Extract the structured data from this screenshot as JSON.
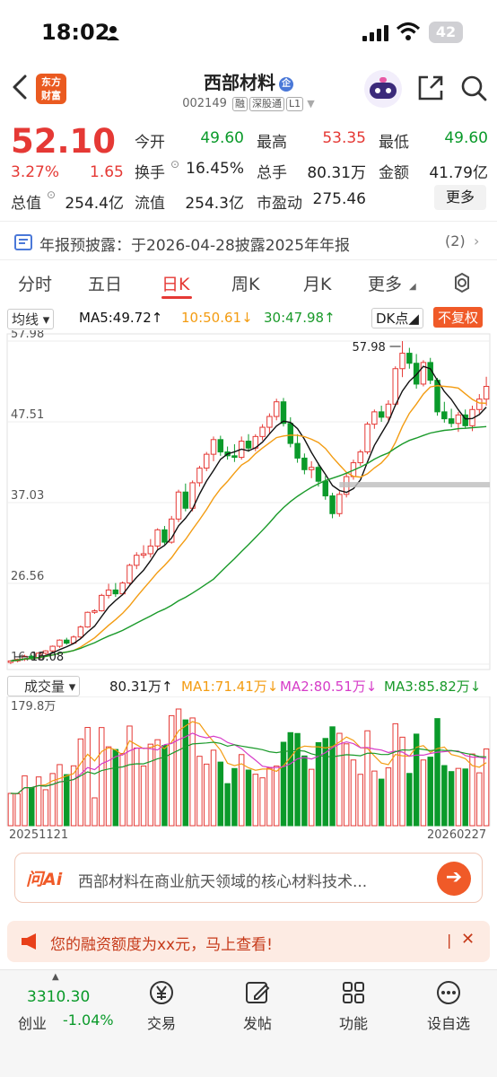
{
  "status": {
    "time": "18:02",
    "battery": "42"
  },
  "nav": {
    "logo_line1": "东方",
    "logo_line2": "财富",
    "name": "西部材料",
    "badge": "企",
    "code": "002149",
    "tags": [
      "融",
      "深股通",
      "L1"
    ]
  },
  "quote": {
    "price": "52.10",
    "pct": "3.27%",
    "change": "1.65",
    "labels": [
      "今开",
      "最高",
      "最低",
      "换手",
      "总手",
      "金额",
      "总值",
      "流值",
      "市盈动"
    ],
    "open": "49.60",
    "high": "53.35",
    "low": "49.60",
    "turnover": "16.45%",
    "volume": "80.31万",
    "amount": "41.79亿",
    "mktcap": "254.4亿",
    "float": "254.3亿",
    "pe": "275.46",
    "more": "更多"
  },
  "notice": {
    "text": "年报预披露：于2026-04-28披露2025年年报",
    "count": "(2)"
  },
  "tabs": [
    "分时",
    "五日",
    "日K",
    "周K",
    "月K",
    "更多"
  ],
  "legend": {
    "avg": "均线",
    "ma5": "MA5:49.72",
    "ma10": "10:50.61",
    "ma30": "30:47.98",
    "dk": "DK点",
    "fq": "不复权"
  },
  "price_axis": [
    "57.98",
    "47.51",
    "37.03",
    "26.56",
    "16.08"
  ],
  "chart_annotations": {
    "high": "57.98",
    "low": "16.08"
  },
  "vol_legend": {
    "type": "成交量",
    "vol": "80.31万",
    "ma1": "MA1:71.41万",
    "ma2": "MA2:80.51万",
    "ma3": "MA3:85.82万",
    "max": "179.8万"
  },
  "dates": {
    "start": "20251121",
    "end": "20260227"
  },
  "ai": {
    "logo": "问Ai",
    "text": "西部材料在商业航天领域的核心材料技术..."
  },
  "promo": {
    "text": "您的融资额度为xx元，马上查看!"
  },
  "bottom": {
    "index_value": "3310.30",
    "index_name": "创业",
    "index_pct": "-1.04%",
    "items": [
      "交易",
      "发帖",
      "功能",
      "设自选"
    ]
  },
  "colors": {
    "up": "#e53935",
    "down": "#0a9a2a",
    "ma5": "#111111",
    "ma10": "#f39c12",
    "ma30": "#1a9a2a"
  },
  "chart_data": {
    "type": "candlestick",
    "x_range": [
      "20251121",
      "20260227"
    ],
    "ylim": [
      16.08,
      57.98
    ],
    "candles": [
      [
        16.3,
        16.6,
        16.1,
        16.5
      ],
      [
        16.5,
        16.8,
        16.3,
        16.7
      ],
      [
        16.7,
        17.3,
        16.5,
        17.1
      ],
      [
        17.1,
        17.3,
        16.7,
        16.9
      ],
      [
        16.9,
        17.6,
        16.8,
        17.5
      ],
      [
        17.5,
        17.9,
        17.3,
        17.8
      ],
      [
        17.8,
        18.5,
        17.6,
        18.4
      ],
      [
        18.4,
        19.3,
        18.2,
        19.2
      ],
      [
        19.2,
        19.5,
        18.6,
        18.8
      ],
      [
        18.8,
        19.8,
        18.7,
        19.6
      ],
      [
        19.6,
        21.1,
        19.4,
        20.9
      ],
      [
        20.9,
        22.9,
        20.8,
        22.8
      ],
      [
        22.8,
        23.2,
        22.6,
        23.0
      ],
      [
        23.0,
        25.2,
        22.9,
        25.0
      ],
      [
        25.0,
        26.5,
        24.6,
        25.7
      ],
      [
        25.7,
        26.6,
        24.8,
        25.2
      ],
      [
        25.2,
        26.8,
        25.0,
        26.6
      ],
      [
        26.6,
        29.1,
        26.4,
        28.9
      ],
      [
        28.9,
        30.6,
        28.4,
        30.2
      ],
      [
        30.2,
        31.5,
        29.8,
        30.4
      ],
      [
        30.4,
        32.3,
        29.9,
        31.4
      ],
      [
        31.4,
        33.7,
        31.0,
        33.5
      ],
      [
        33.5,
        34.0,
        31.6,
        31.9
      ],
      [
        31.9,
        35.3,
        31.7,
        34.9
      ],
      [
        34.9,
        38.7,
        34.5,
        38.4
      ],
      [
        38.4,
        39.5,
        35.9,
        36.3
      ],
      [
        36.3,
        39.9,
        35.9,
        39.6
      ],
      [
        39.6,
        41.8,
        39.1,
        41.5
      ],
      [
        41.5,
        43.6,
        41.1,
        43.3
      ],
      [
        43.3,
        45.6,
        42.4,
        45.2
      ],
      [
        45.2,
        45.7,
        43.1,
        43.6
      ],
      [
        43.6,
        44.3,
        42.6,
        43.1
      ],
      [
        43.1,
        44.6,
        42.3,
        42.9
      ],
      [
        42.9,
        45.6,
        42.6,
        45.0
      ],
      [
        45.0,
        45.9,
        43.6,
        44.1
      ],
      [
        44.1,
        45.9,
        43.7,
        45.6
      ],
      [
        45.6,
        47.2,
        45.1,
        46.8
      ],
      [
        46.8,
        48.6,
        46.0,
        48.2
      ],
      [
        48.2,
        50.5,
        47.7,
        50.1
      ],
      [
        50.1,
        50.6,
        46.9,
        47.3
      ],
      [
        47.3,
        48.1,
        44.2,
        44.7
      ],
      [
        44.7,
        45.9,
        42.2,
        42.8
      ],
      [
        42.8,
        43.4,
        40.7,
        41.3
      ],
      [
        41.3,
        42.4,
        40.2,
        41.6
      ],
      [
        41.6,
        42.2,
        39.1,
        39.8
      ],
      [
        39.8,
        40.5,
        37.4,
        37.9
      ],
      [
        37.9,
        38.3,
        35.0,
        35.6
      ],
      [
        35.6,
        38.5,
        35.2,
        38.1
      ],
      [
        38.1,
        40.8,
        37.7,
        40.4
      ],
      [
        40.4,
        42.6,
        40.0,
        42.2
      ],
      [
        42.2,
        43.9,
        41.8,
        43.6
      ],
      [
        43.6,
        47.5,
        43.3,
        47.2
      ],
      [
        47.2,
        49.1,
        46.6,
        48.8
      ],
      [
        48.8,
        49.6,
        47.5,
        48.1
      ],
      [
        48.1,
        50.3,
        47.6,
        49.8
      ],
      [
        49.8,
        54.7,
        49.5,
        54.4
      ],
      [
        54.4,
        57.98,
        53.3,
        56.4
      ],
      [
        56.4,
        57.1,
        54.4,
        55.1
      ],
      [
        55.1,
        56.3,
        51.8,
        52.4
      ],
      [
        52.4,
        55.5,
        52.1,
        55.2
      ],
      [
        55.2,
        55.8,
        52.4,
        52.9
      ],
      [
        52.9,
        53.2,
        48.3,
        48.8
      ],
      [
        48.8,
        50.1,
        47.4,
        47.9
      ],
      [
        47.9,
        49.2,
        46.8,
        47.3
      ],
      [
        47.3,
        48.8,
        46.2,
        48.4
      ],
      [
        48.4,
        49.1,
        46.6,
        47.0
      ],
      [
        47.0,
        49.6,
        46.3,
        49.1
      ],
      [
        49.1,
        51.1,
        48.6,
        50.45
      ],
      [
        50.45,
        53.35,
        49.6,
        52.1
      ]
    ]
  }
}
